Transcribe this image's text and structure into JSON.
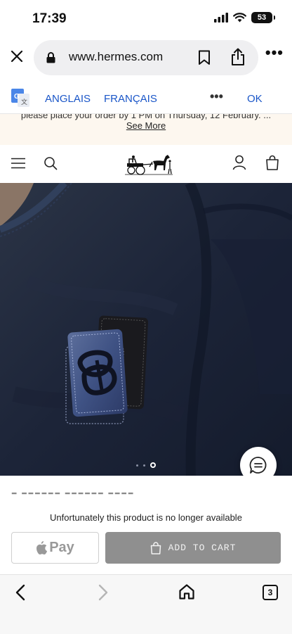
{
  "status_bar": {
    "time": "17:39",
    "battery": "53",
    "signal_icon": "cellular-signal-icon",
    "wifi_icon": "wifi-icon"
  },
  "browser": {
    "url": "www.hermes.com",
    "close_icon": "close-icon",
    "lock_icon": "lock-icon",
    "bookmark_icon": "bookmark-icon",
    "share_icon": "share-icon",
    "more_label": "•••"
  },
  "translate_bar": {
    "source_language": "ANGLAIS",
    "target_language": "FRANÇAIS",
    "more_label": "•••",
    "ok_label": "OK",
    "accent_color": "#1a56c8"
  },
  "announcement": {
    "text": "please place your order by 1 PM on Thursday, 12 February. ...",
    "see_more": "See More"
  },
  "site_header": {
    "menu_icon": "hamburger-menu-icon",
    "search_icon": "search-icon",
    "logo": "hermes-carriage-logo",
    "account_icon": "account-icon",
    "bag_icon": "shopping-bag-icon"
  },
  "product": {
    "image": "navy-tshirt-with-leather-patch",
    "carousel": {
      "total": 3,
      "active": 3
    },
    "chat_icon": "chat-icon",
    "unavailable_message": "Unfortunately this product is no longer available",
    "apple_pay_label": "Pay",
    "add_to_cart_label": "ADD TO CART",
    "add_to_cart_color": "#8f8f8f"
  },
  "bottom_bar": {
    "back_icon": "back-arrow-icon",
    "forward_icon": "forward-arrow-icon",
    "home_icon": "home-icon",
    "tab_count": "3"
  }
}
